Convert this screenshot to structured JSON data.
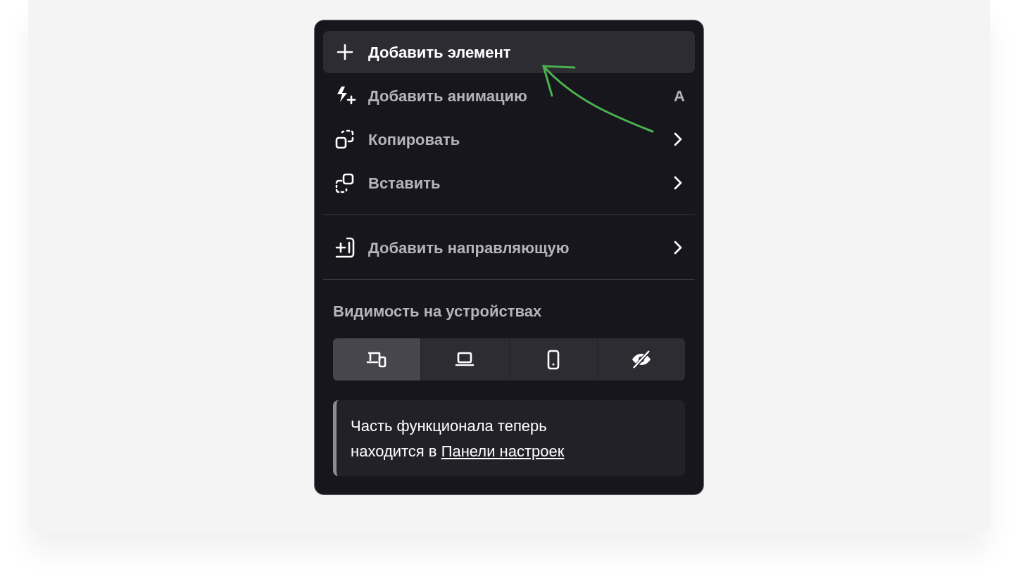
{
  "menu": {
    "items": [
      {
        "kind": "action",
        "label": "Добавить элемент",
        "selected": true
      },
      {
        "kind": "action",
        "label": "Добавить анимацию",
        "shortcut": "A",
        "selected": false
      },
      {
        "kind": "submenu",
        "label": "Копировать",
        "selected": false
      },
      {
        "kind": "submenu",
        "label": "Вставить",
        "selected": false
      },
      {
        "kind": "divider"
      },
      {
        "kind": "submenu",
        "label": "Добавить направляющую",
        "selected": false
      },
      {
        "kind": "divider"
      }
    ],
    "visibility": {
      "heading": "Видимость на устройствах",
      "devices": [
        {
          "selected": true
        },
        {
          "selected": false
        },
        {
          "selected": false
        },
        {
          "selected": false
        }
      ]
    },
    "note": {
      "text": "Часть функционала теперь находится в ",
      "link": "Панели настроек"
    }
  },
  "annotation": {
    "kind": "arrow"
  }
}
